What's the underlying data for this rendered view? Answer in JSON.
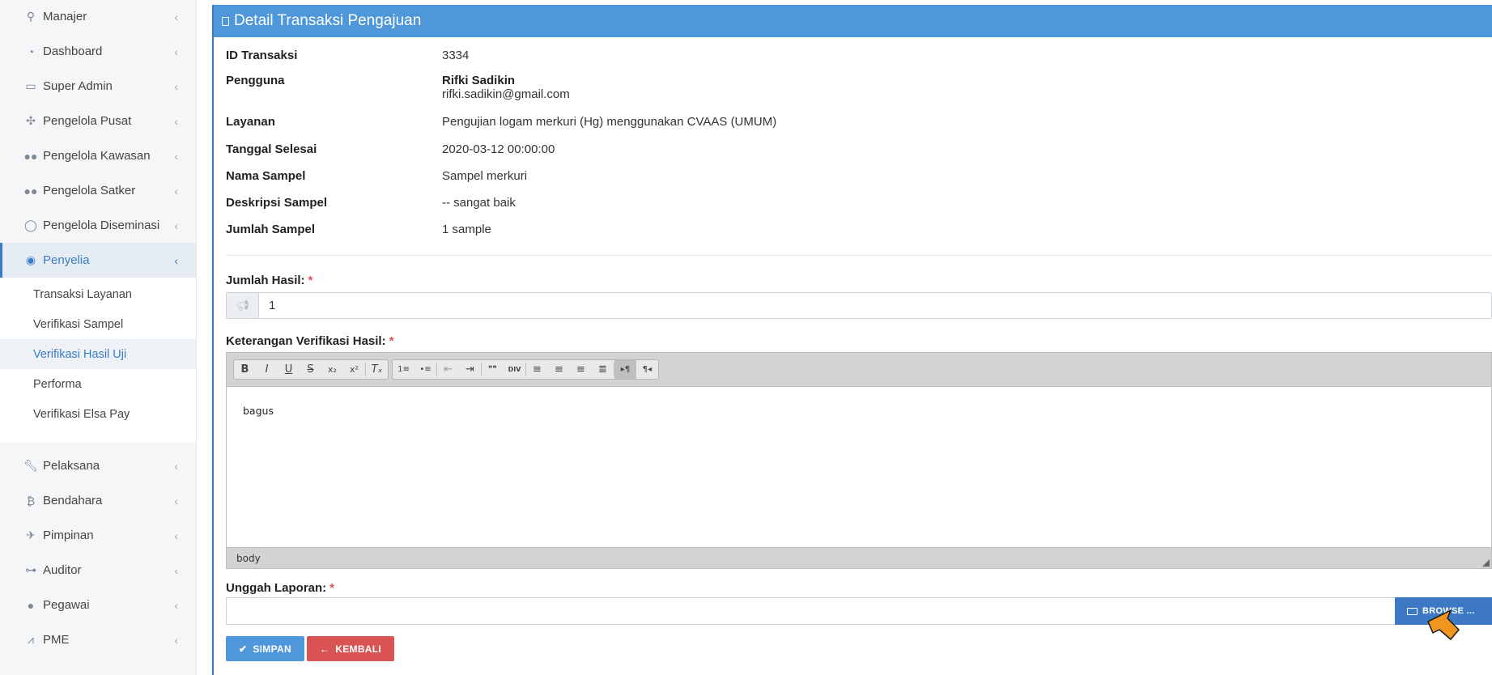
{
  "sidebar": {
    "top_items": [
      {
        "label": "Manajer",
        "icon": "key-icon"
      },
      {
        "label": "Dashboard",
        "icon": "dashboard-icon"
      },
      {
        "label": "Super Admin",
        "icon": "desktop-icon"
      },
      {
        "label": "Pengelola Pusat",
        "icon": "arrows-icon"
      },
      {
        "label": "Pengelola Kawasan",
        "icon": "users-icon"
      },
      {
        "label": "Pengelola Satker",
        "icon": "users-icon"
      },
      {
        "label": "Pengelola Diseminasi",
        "icon": "shield-icon"
      },
      {
        "label": "Penyelia",
        "icon": "eye-icon"
      }
    ],
    "sub_items": [
      {
        "label": "Transaksi Layanan"
      },
      {
        "label": "Verifikasi Sampel"
      },
      {
        "label": "Verifikasi Hasil Uji"
      },
      {
        "label": "Performa"
      },
      {
        "label": "Verifikasi Elsa Pay"
      }
    ],
    "bottom_items": [
      {
        "label": "Pelaksana",
        "icon": "wrench-icon"
      },
      {
        "label": "Bendahara",
        "icon": "bitcoin-icon"
      },
      {
        "label": "Pimpinan",
        "icon": "plane-icon"
      },
      {
        "label": "Auditor",
        "icon": "binoculars-icon"
      },
      {
        "label": "Pegawai",
        "icon": "user-icon"
      },
      {
        "label": "PME",
        "icon": "road-icon"
      }
    ]
  },
  "panel": {
    "title": "Detail Transaksi Pengajuan"
  },
  "details": {
    "id_label": "ID Transaksi",
    "id_value": "3334",
    "user_label": "Pengguna",
    "user_name": "Rifki Sadikin",
    "user_email": "rifki.sadikin@gmail.com",
    "service_label": "Layanan",
    "service_value": "Pengujian logam merkuri (Hg) menggunakan CVAAS (UMUM)",
    "date_label": "Tanggal Selesai",
    "date_value": "2020-03-12 00:00:00",
    "sample_name_label": "Nama Sampel",
    "sample_name_value": "Sampel merkuri",
    "sample_desc_label": "Deskripsi Sampel",
    "sample_desc_value": "-- sangat baik",
    "sample_count_label": "Jumlah Sampel",
    "sample_count_value": "1 sample"
  },
  "form": {
    "result_count_label": "Jumlah Hasil:",
    "required_mark": "*",
    "result_count_value": "1",
    "notes_label": "Keterangan Verifikasi Hasil:",
    "editor": {
      "toolbar": {
        "bold": "B",
        "italic": "I",
        "underline": "U",
        "strike": "S",
        "subscript": "x₂",
        "superscript": "x²",
        "remove_format": "Tₓ",
        "numbered_list": "1≡",
        "bulleted_list": "•≡",
        "outdent": "⇤",
        "indent": "⇥",
        "blockquote": "❞❞",
        "div": "DIV",
        "align_left": "≡",
        "align_center": "≡",
        "align_right": "≡",
        "justify": "≣",
        "ltr": "▸¶",
        "rtl": "¶◂"
      },
      "content": "bagus",
      "status_path": "body"
    },
    "upload_label": "Unggah Laporan:",
    "browse_label": "BROWSE ..."
  },
  "actions": {
    "save_label": "SIMPAN",
    "back_label": "KEMBALI"
  },
  "colors": {
    "primary": "#4e97db",
    "danger": "#d95355",
    "active_text": "#3a7bc8",
    "cursor": "#f0961f"
  }
}
